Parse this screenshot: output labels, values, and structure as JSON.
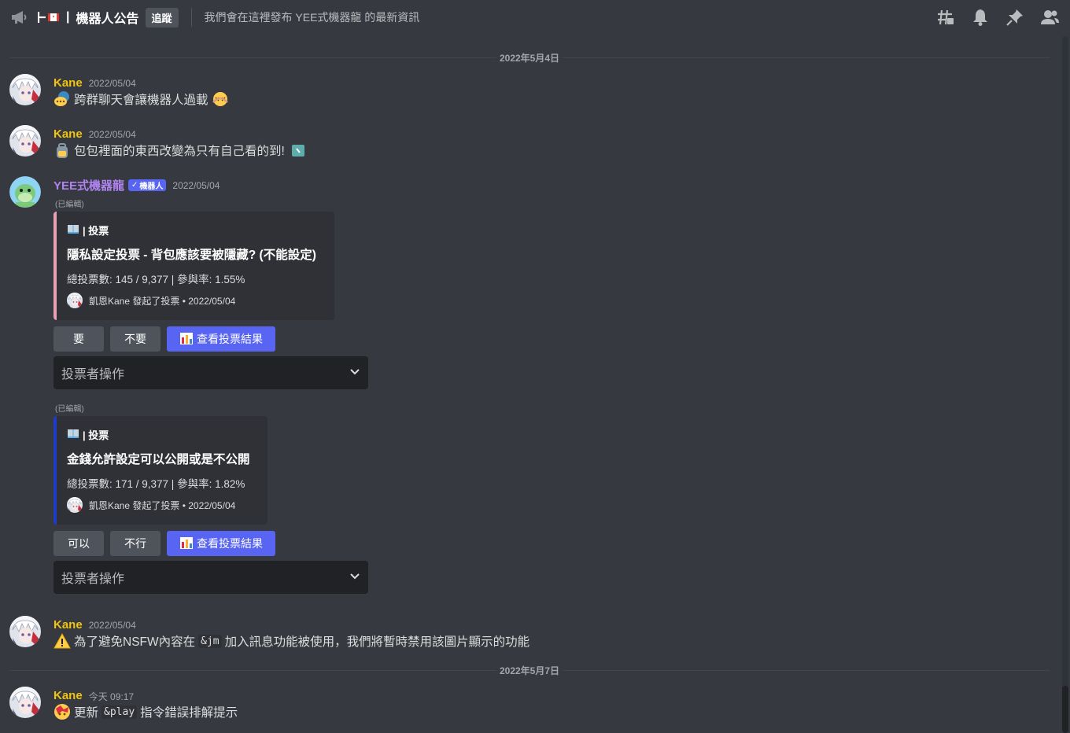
{
  "header": {
    "channel_name": "機器人公告",
    "follow_label": "追蹤",
    "topic": "我們會在這裡發布 YEE式機器龍 的最新資訊"
  },
  "dividers": [
    "2022年5月4日",
    "2022年5月7日"
  ],
  "messages": [
    {
      "author": "Kane",
      "time": "2022/05/04",
      "text": "跨群聊天會讓機器人過載"
    },
    {
      "author": "Kane",
      "time": "2022/05/04",
      "text": "包包裡面的東西改變為只有自己看的到!"
    },
    {
      "author": "YEE式機器龍",
      "bot_tag": "機器人",
      "time": "2022/05/04"
    },
    {
      "author": "Kane",
      "time": "2022/05/04",
      "text_before": "為了避免NSFW內容在",
      "code": "&jm",
      "text_after": "加入訊息功能被使用，我們將暫時禁用該圖片顯示的功能"
    },
    {
      "author": "Kane",
      "time": "今天 09:17",
      "text_before": "更新",
      "code": "&play",
      "text_after": "指令錯誤排解提示"
    }
  ],
  "edited_label": "(已編輯)",
  "polls": [
    {
      "author": "| 投票",
      "title": "隱私設定投票 - 背包應該要被隱藏? (不能設定)",
      "desc": "總投票數: 145 / 9,377 | 參與率: 1.55%",
      "footer": "凱恩Kane 發起了投票 • 2022/05/04",
      "options": [
        "要",
        "不要"
      ],
      "results_label": "查看投票結果",
      "select_placeholder": "投票者操作"
    },
    {
      "author": "| 投票",
      "title": "金錢允許設定可以公開或是不公開",
      "desc": "總投票數: 171 / 9,377 | 參與率: 1.82%",
      "footer": "凱恩Kane 發起了投票 • 2022/05/04",
      "options": [
        "可以",
        "不行"
      ],
      "results_label": "查看投票結果",
      "select_placeholder": "投票者操作"
    }
  ],
  "colors": {
    "background": "#36393f",
    "author_user": "#f1c40f",
    "author_bot": "#b083f0",
    "blurple": "#5865f2",
    "embed_pink": "#e8a0b4",
    "embed_blue": "#1e3cc8"
  }
}
